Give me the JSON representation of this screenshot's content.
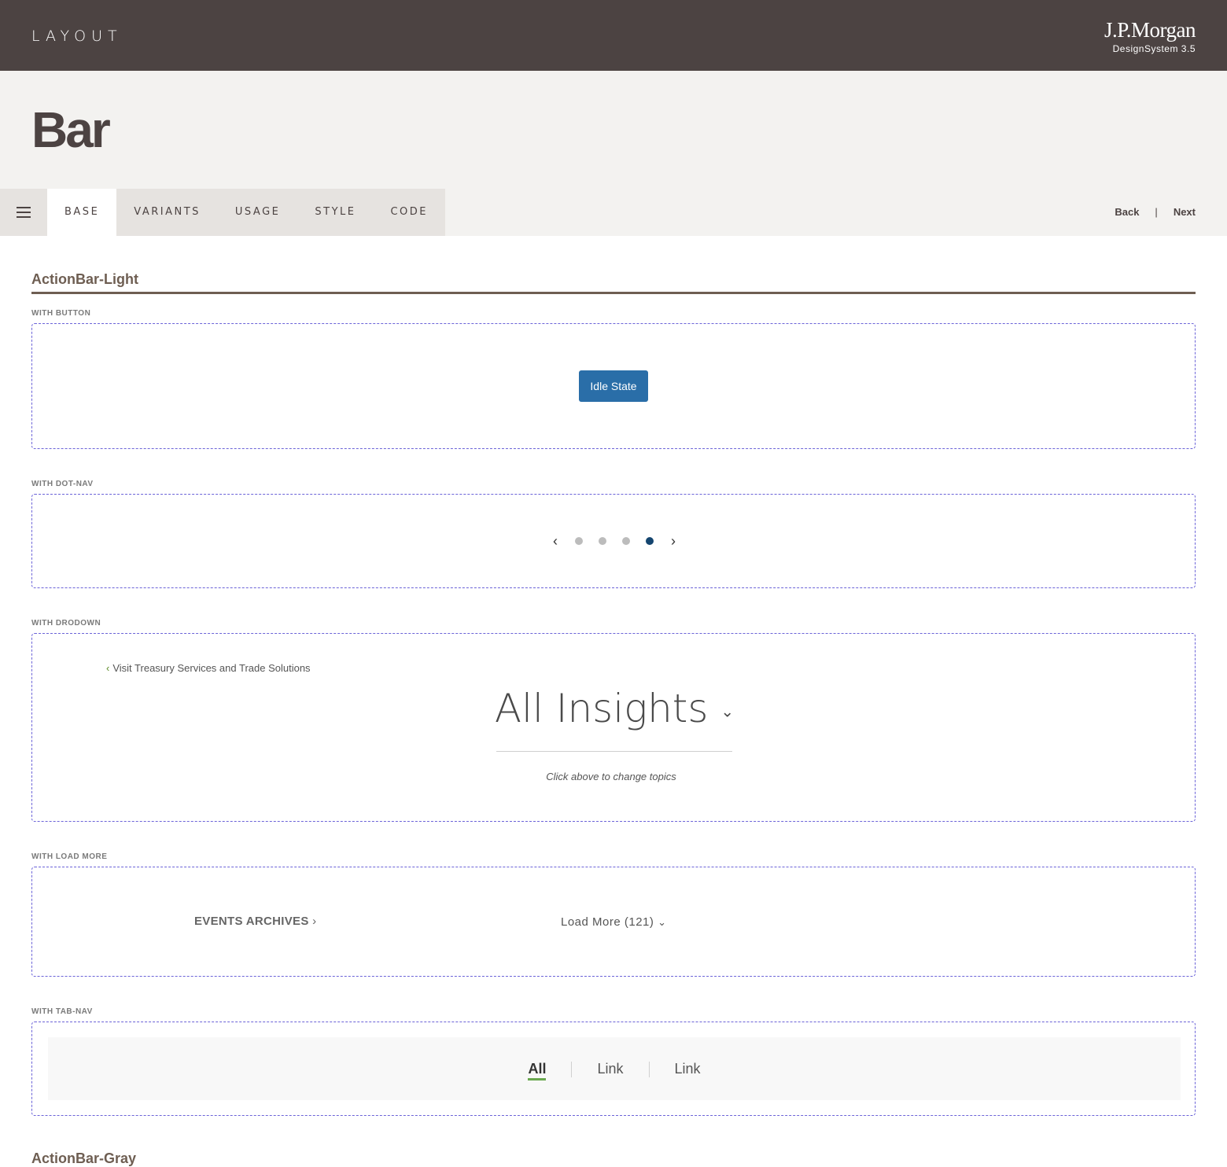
{
  "header": {
    "section": "LAYOUT",
    "brand": "J.P.Morgan",
    "version": "DesignSystem  3.5"
  },
  "page": {
    "title": "Bar"
  },
  "tabs": [
    {
      "label": "BASE"
    },
    {
      "label": "VARIANTS"
    },
    {
      "label": "USAGE"
    },
    {
      "label": "STYLE"
    },
    {
      "label": "CODE"
    }
  ],
  "active_tab": "BASE",
  "pager": {
    "back": "Back",
    "separator": "|",
    "next": "Next"
  },
  "content": {
    "section1_title": "ActionBar-Light",
    "section2_title": "ActionBar-Gray",
    "with_button": {
      "label": "WITH BUTTON",
      "button_label": "Idle State"
    },
    "with_dotnav": {
      "label": "WITH DOT-NAV",
      "prev_icon": "chevron-left-icon",
      "next_icon": "chevron-right-icon",
      "dot_count": 4,
      "active_dot": 4
    },
    "with_dropdown": {
      "label": "WITH DRODOWN",
      "back_link": "Visit Treasury Services and Trade Solutions",
      "heading": "All Insights",
      "hint": "Click above to change topics"
    },
    "with_load_more": {
      "label": "WITH LOAD MORE",
      "events_link": "EVENTS ARCHIVES",
      "load_more": "Load More (121)"
    },
    "with_tabnav": {
      "label": "WITH TAB-NAV",
      "links": [
        "All",
        "Link",
        "Link"
      ],
      "active_index": 0
    }
  },
  "colors": {
    "header_bg": "#4c4342",
    "hero_bg": "#f3f2f0",
    "primary_button": "#2a6ea8",
    "active_dot": "#14456f",
    "accent_green": "#6aa84f",
    "dashed_border": "#6b63d8"
  }
}
